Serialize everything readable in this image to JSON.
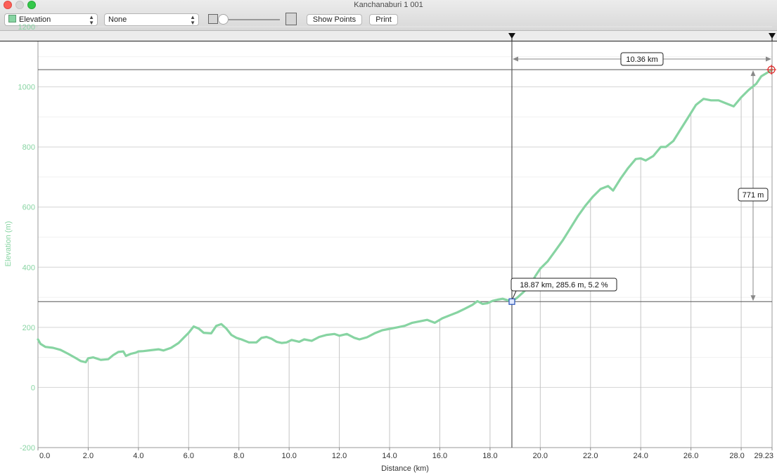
{
  "window": {
    "title": "Kanchanaburi 1 001"
  },
  "toolbar": {
    "y_axis_select": "Elevation",
    "secondary_select": "None",
    "show_points_label": "Show Points",
    "print_label": "Print",
    "swatch_color": "#87d4a2"
  },
  "chart_data": {
    "type": "line",
    "xlabel": "Distance (km)",
    "ylabel": "Elevation (m)",
    "xlim": [
      0,
      29.23
    ],
    "ylim": [
      -200,
      1200
    ],
    "x_ticks": [
      "0.0",
      "2.0",
      "4.0",
      "6.0",
      "8.0",
      "10.0",
      "12.0",
      "14.0",
      "16.0",
      "18.0",
      "20.0",
      "22.0",
      "24.0",
      "26.0",
      "28.0",
      "29.23"
    ],
    "y_ticks": [
      "-200",
      "0",
      "200",
      "400",
      "600",
      "800",
      "1000",
      "1200"
    ],
    "line_color": "#87d4a2",
    "grid": true,
    "series": [
      {
        "x": [
          0.0,
          0.1,
          0.3,
          0.6,
          0.9,
          1.2,
          1.5,
          1.7,
          1.9,
          2.0,
          2.2,
          2.5,
          2.8,
          3.0,
          3.2,
          3.4,
          3.5,
          3.7,
          3.9,
          4.0,
          4.2,
          4.5,
          4.8,
          5.0,
          5.3,
          5.6,
          5.8,
          6.0,
          6.2,
          6.4,
          6.6,
          6.9,
          7.1,
          7.3,
          7.5,
          7.7,
          7.9,
          8.1,
          8.4,
          8.7,
          8.9,
          9.1,
          9.3,
          9.5,
          9.7,
          9.9,
          10.1,
          10.4,
          10.6,
          10.9,
          11.2,
          11.5,
          11.8,
          12.0,
          12.3,
          12.6,
          12.8,
          13.1,
          13.4,
          13.7,
          14.0,
          14.3,
          14.6,
          14.9,
          15.2,
          15.5,
          15.8,
          16.1,
          16.4,
          16.7,
          17.0,
          17.3,
          17.5,
          17.7,
          17.9,
          18.1,
          18.3,
          18.5,
          18.87,
          19.1,
          19.3,
          19.6,
          19.8,
          20.0,
          20.3,
          20.6,
          20.9,
          21.2,
          21.5,
          21.8,
          22.1,
          22.4,
          22.7,
          22.9,
          23.2,
          23.5,
          23.8,
          24.0,
          24.2,
          24.5,
          24.8,
          25.0,
          25.3,
          25.6,
          25.9,
          26.2,
          26.5,
          26.8,
          27.1,
          27.4,
          27.7,
          28.0,
          28.3,
          28.6,
          28.8,
          29.0,
          29.23
        ],
        "y": [
          160,
          145,
          135,
          132,
          125,
          112,
          98,
          88,
          84,
          97,
          100,
          92,
          94,
          108,
          118,
          120,
          105,
          112,
          116,
          120,
          121,
          124,
          127,
          123,
          132,
          148,
          165,
          182,
          203,
          196,
          182,
          180,
          205,
          211,
          196,
          175,
          165,
          160,
          150,
          150,
          165,
          168,
          162,
          152,
          148,
          150,
          158,
          152,
          160,
          155,
          168,
          175,
          178,
          172,
          178,
          165,
          160,
          167,
          180,
          190,
          195,
          200,
          205,
          215,
          220,
          225,
          215,
          230,
          240,
          250,
          262,
          275,
          287,
          278,
          280,
          288,
          292,
          295,
          285.6,
          300,
          315,
          340,
          370,
          395,
          420,
          455,
          490,
          530,
          570,
          605,
          635,
          660,
          670,
          655,
          695,
          730,
          760,
          762,
          755,
          770,
          800,
          800,
          820,
          860,
          900,
          940,
          960,
          955,
          955,
          945,
          935,
          965,
          990,
          1010,
          1035,
          1045,
          1057
        ]
      }
    ],
    "selection": {
      "start_km": 18.87,
      "end_km": 29.23,
      "distance_label": "10.36 km",
      "elevation_gain_label": "771 m",
      "start_elevation": 285.6,
      "end_elevation": 1057,
      "point_label": "18.87 km, 285.6 m, 5.2 %"
    }
  }
}
